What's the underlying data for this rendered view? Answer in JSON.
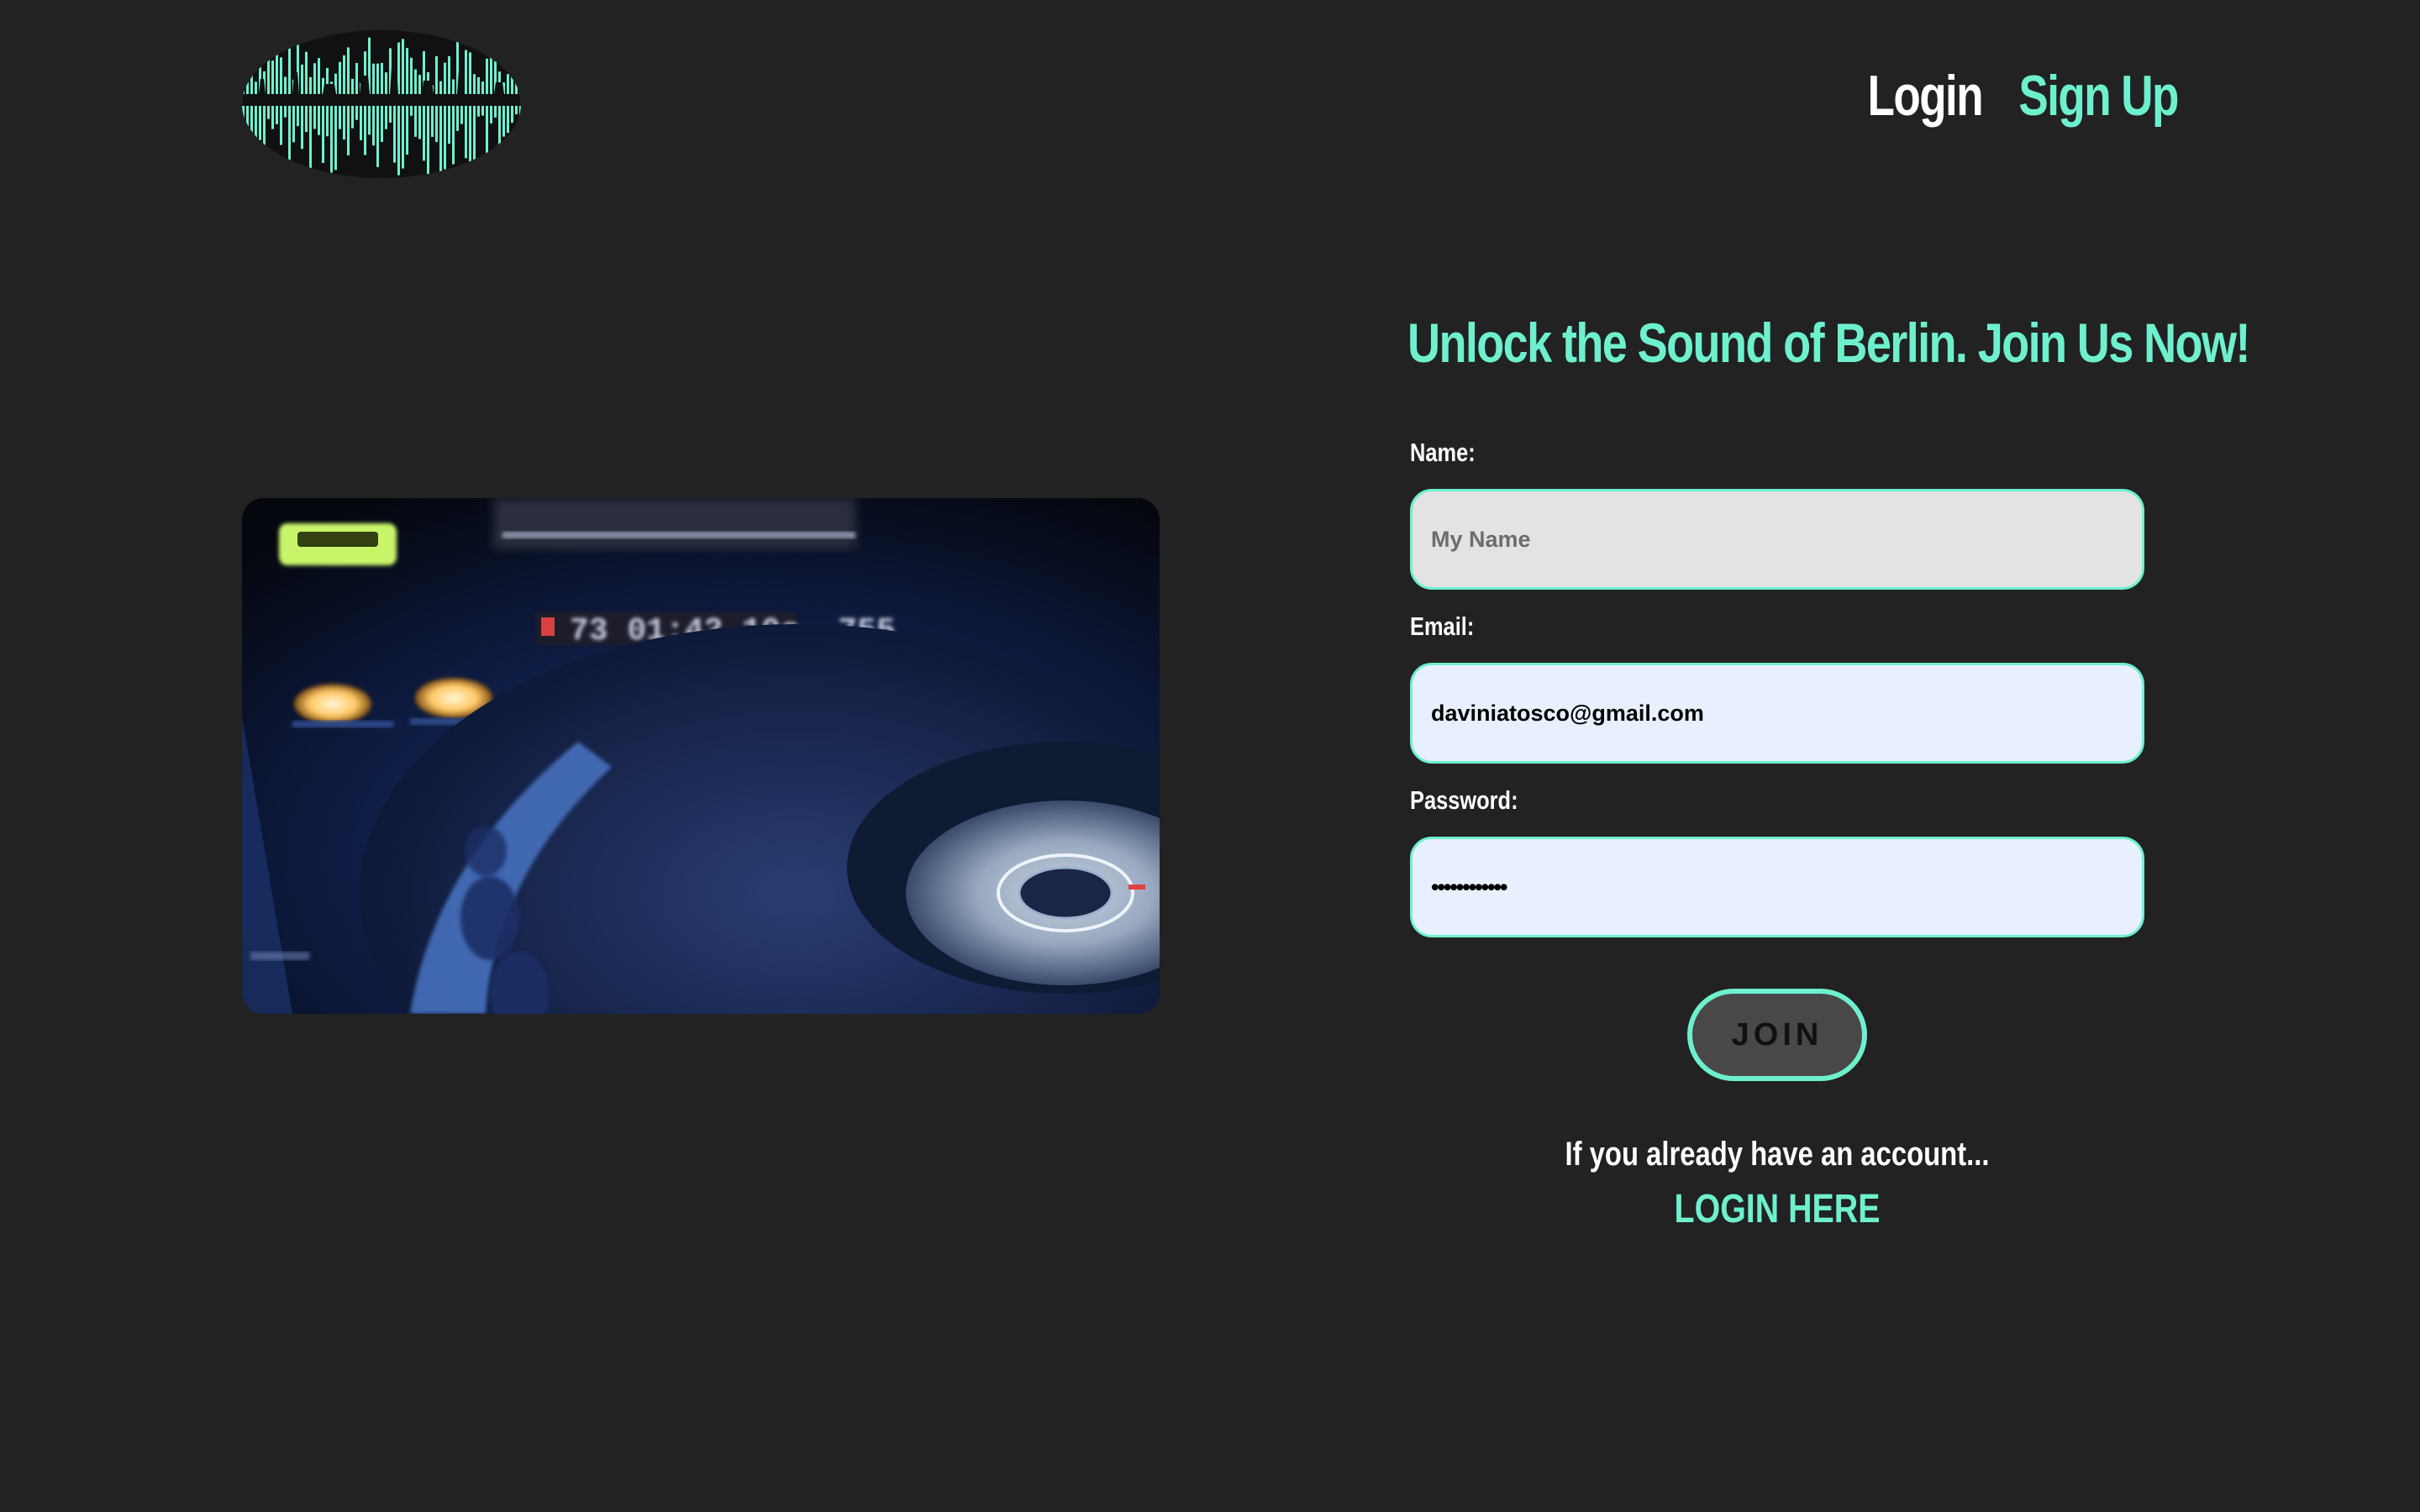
{
  "header": {
    "logo_icon": "berlin-skyline-soundwave-logo",
    "nav": {
      "login_label": "Login",
      "signup_label": "Sign Up"
    }
  },
  "main": {
    "hero_image_icon": "dj-turntable-photo",
    "headline": "Unlock the Sound of Berlin. Join Us Now!",
    "form": {
      "name_label": "Name:",
      "name_placeholder": "My Name",
      "name_value": "",
      "email_label": "Email:",
      "email_value": "daviniatosco@gmail.com",
      "password_label": "Password:",
      "password_value": "••••••••••••",
      "join_label": "JOIN"
    },
    "footer_prompt": "If you already have an account...",
    "login_here_label": "LOGIN HERE"
  },
  "colors": {
    "background": "#222222",
    "accent": "#6ef0cf",
    "autofill_bg": "#e8f0fe",
    "empty_input_bg": "#e3e3e3",
    "button_bg": "#4a4747"
  }
}
